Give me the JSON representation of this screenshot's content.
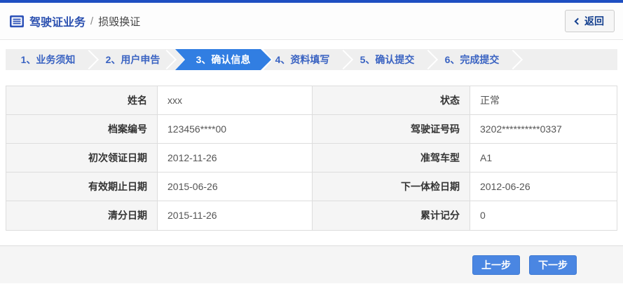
{
  "colors": {
    "top_bar": "#1e4fc2",
    "title": "#2b50b0",
    "step_text": "#3a63c2",
    "step_active_bg": "#317ee2",
    "step_bar_bg": "#efefef",
    "label_cell_bg": "#f5f5f5",
    "border": "#dddddd",
    "button_bg": "#4a86e2"
  },
  "header": {
    "title": "驾驶证业务",
    "breadcrumb_separator": "/",
    "subtitle": "损毁换证",
    "back_label": "返回",
    "icons": [
      "list-icon",
      "chevron-left-icon"
    ]
  },
  "steps": {
    "active_index": 2,
    "items": [
      {
        "label": "1、业务须知"
      },
      {
        "label": "2、用户申告"
      },
      {
        "label": "3、确认信息"
      },
      {
        "label": "4、资料填写"
      },
      {
        "label": "5、确认提交"
      },
      {
        "label": "6、完成提交"
      }
    ]
  },
  "info_table": {
    "rows": [
      {
        "label_left": "姓名",
        "value_left": "xxx",
        "label_right": "状态",
        "value_right": "正常"
      },
      {
        "label_left": "档案编号",
        "value_left": "123456****00",
        "label_right": "驾驶证号码",
        "value_right": "3202**********0337"
      },
      {
        "label_left": "初次领证日期",
        "value_left": "2012-11-26",
        "label_right": "准驾车型",
        "value_right": "A1"
      },
      {
        "label_left": "有效期止日期",
        "value_left": "2015-06-26",
        "label_right": "下一体检日期",
        "value_right": "2012-06-26"
      },
      {
        "label_left": "清分日期",
        "value_left": "2015-11-26",
        "label_right": "累计记分",
        "value_right": "0"
      }
    ]
  },
  "footer": {
    "prev_label": "上一步",
    "next_label": "下一步"
  }
}
